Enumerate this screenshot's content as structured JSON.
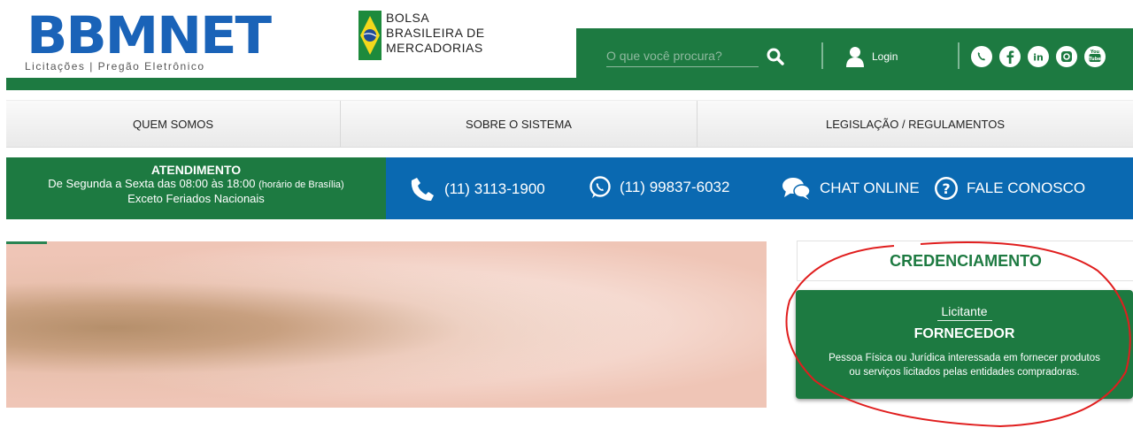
{
  "logo": {
    "text": "BBMNET",
    "subtitle": "Licitações | Pregão Eletrônico"
  },
  "partner": {
    "lines": [
      "BOLSA",
      "BRASILEIRA DE",
      "MERCADORIAS"
    ]
  },
  "search": {
    "placeholder": "O que você procura?"
  },
  "login": {
    "label": "Login"
  },
  "social": [
    "whatsapp-icon",
    "facebook-icon",
    "linkedin-icon",
    "instagram-icon",
    "youtube-icon"
  ],
  "nav": [
    {
      "label": "QUEM SOMOS"
    },
    {
      "label": "SOBRE O SISTEMA"
    },
    {
      "label": "LEGISLAÇÃO / REGULAMENTOS"
    }
  ],
  "atendimento": {
    "title": "ATENDIMENTO",
    "line1": "De Segunda a Sexta das 08:00 às 18:00",
    "line1_small": "(horário de Brasília)",
    "line2": "Exceto Feriados Nacionais"
  },
  "contacts": {
    "phone": "(11) 3113-1900",
    "whatsapp": "(11) 99837-6032",
    "chat": "CHAT ONLINE",
    "contact": "FALE CONOSCO"
  },
  "credenciamento": {
    "title": "CREDENCIAMENTO",
    "subtitle": "Licitante",
    "heading": "FORNECEDOR",
    "desc_line1": "Pessoa Física ou Jurídica interessada em fornecer produtos",
    "desc_line2": "ou serviços licitados pelas entidades compradoras."
  },
  "colors": {
    "green": "#1d7a41",
    "blue": "#0a69b1",
    "logo_blue": "#1a63b8",
    "annotation_red": "#e01e1e"
  }
}
